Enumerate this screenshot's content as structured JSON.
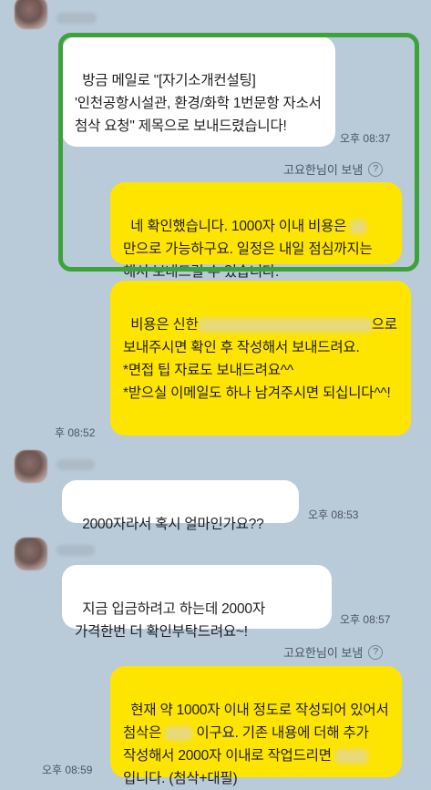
{
  "messages": {
    "m1_text": "방금 메일로 \"[자기소개컨설팅] '인천공항시설관, 환경/화학 1번문항 자소서 첨삭 요청\" 제목으로 보내드렸습니다!",
    "m1_time": "오후 08:37",
    "via1": "고요한님이 보냄",
    "m2_a": "네 확인했습니다. 1000자 이내 비용은 ",
    "m2_b": "만으로 가능하구요. 일정은 내일 점심까지는 해서 보내드릴 수 있습니다.",
    "m3_a": "비용은 신한",
    "m3_b": "으로 보내주시면 확인 후 작성해서 보내드려요.\n*면접 팁 자료도 보내드려요^^\n*받으실 이메일도 하나 남겨주시면 되십니다^^!",
    "m3_time": "후 08:52",
    "m4_text": "2000자라서 혹시 얼마인가요??",
    "m4_time": "오후 08:53",
    "m5_text": "지금 입금하려고 하는데 2000자 가격한번 더 확인부탁드려요~!",
    "m5_time": "오후 08:57",
    "via2": "고요한님이 보냄",
    "m6_a": "현재 약 1000자 이내 정도로 작성되어 있어서 첨삭은 ",
    "m6_b": " 이구요. 기존 내용에 더해 추가 작성해서 2000자 이내로 작업드리면 ",
    "m6_c": " 입니다. (첨삭+대필)",
    "m6_time": "오후 08:59"
  },
  "icons": {
    "help": "?"
  },
  "colors": {
    "background": "#b9cad8",
    "incoming_bubble": "#ffffff",
    "outgoing_bubble": "#fee500",
    "highlight_border": "#3ea23a"
  }
}
